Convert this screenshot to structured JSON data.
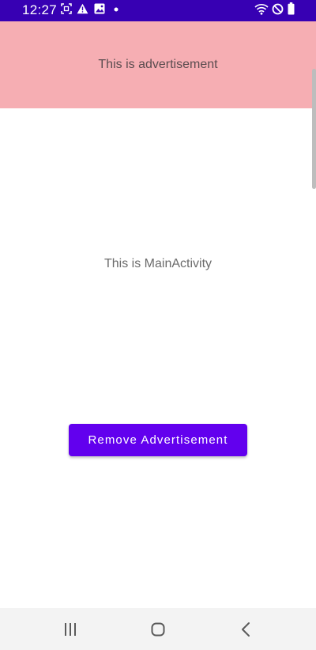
{
  "status_bar": {
    "time": "12:27",
    "icons_left": [
      "screenshot-icon",
      "warning-icon",
      "image-icon",
      "dot-icon"
    ],
    "icons_right": [
      "wifi-icon",
      "do-not-disturb-icon",
      "battery-icon"
    ],
    "background": "#3700b3"
  },
  "ad_banner": {
    "text": "This is advertisement",
    "background": "#f6aeb3"
  },
  "main": {
    "text": "This is MainActivity"
  },
  "remove_button": {
    "label": "Remove Advertisement",
    "background": "#6200ee"
  },
  "nav_bar": {
    "buttons": [
      "recent-apps-icon",
      "home-icon",
      "back-icon"
    ]
  }
}
